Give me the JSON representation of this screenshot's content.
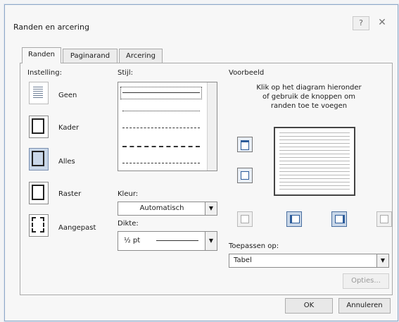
{
  "dialog": {
    "title": "Randen en arcering",
    "help_glyph": "?",
    "close_glyph": "✕"
  },
  "tabs": [
    {
      "label": "Randen",
      "active": true
    },
    {
      "label": "Paginarand",
      "active": false
    },
    {
      "label": "Arcering",
      "active": false
    }
  ],
  "settings": {
    "heading": "Instelling:",
    "items": [
      {
        "label": "Geen",
        "icon": "none-border-icon"
      },
      {
        "label": "Kader",
        "icon": "box-border-icon"
      },
      {
        "label": "Alles",
        "icon": "all-borders-icon",
        "selected": true
      },
      {
        "label": "Raster",
        "icon": "grid-border-icon"
      },
      {
        "label": "Aangepast",
        "icon": "custom-border-icon"
      }
    ]
  },
  "style": {
    "heading": "Stijl:"
  },
  "color": {
    "heading": "Kleur:",
    "value": "Automatisch"
  },
  "width": {
    "heading": "Dikte:",
    "value": "½ pt"
  },
  "preview": {
    "heading": "Voorbeeld",
    "instruction": [
      "Klik op het diagram hieronder",
      "of gebruik de knoppen om",
      "randen toe te voegen"
    ]
  },
  "apply_to": {
    "heading": "Toepassen op:",
    "value": "Tabel"
  },
  "buttons": {
    "options": "Opties...",
    "ok": "OK",
    "cancel": "Annuleren"
  },
  "colors": {
    "accent": "#2d5c9a",
    "selected_bg": "#c9d7e8",
    "window_bg": "#f7f7f7"
  }
}
